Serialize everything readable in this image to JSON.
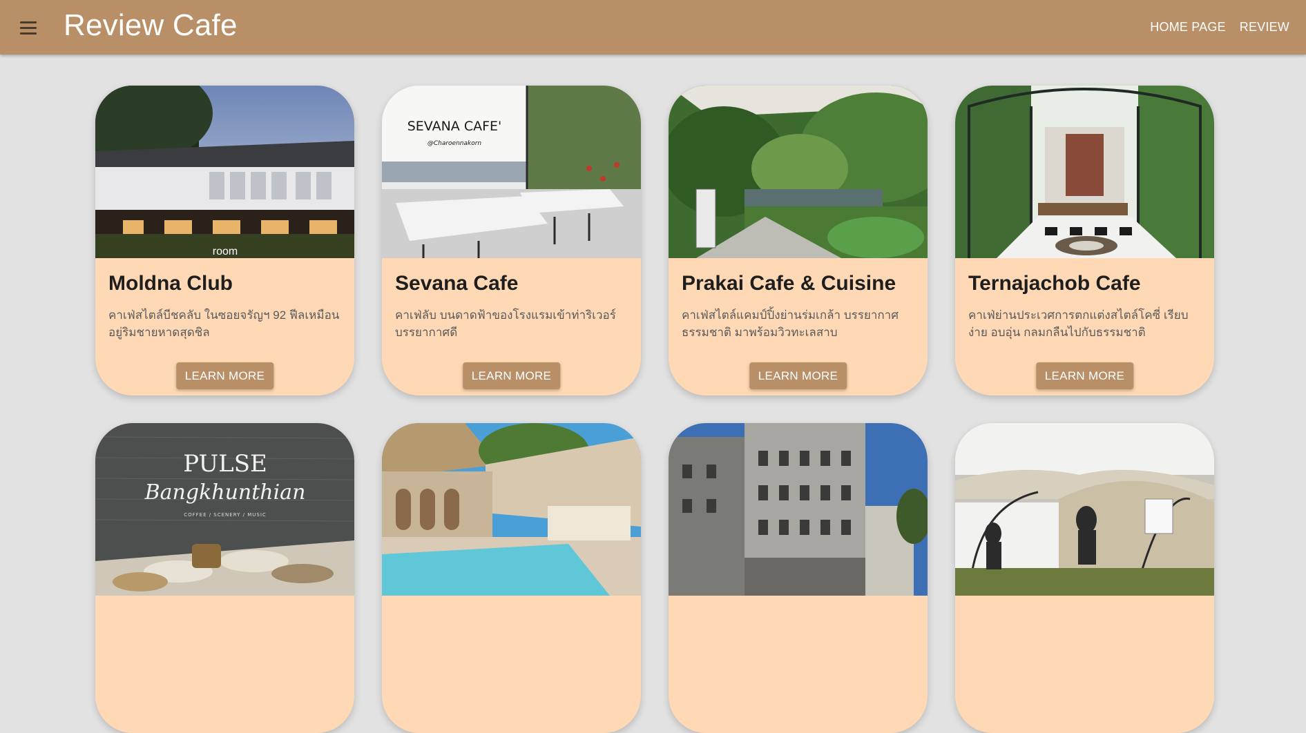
{
  "app": {
    "title": "Review Cafe",
    "nav": [
      "HOME PAGE",
      "REVIEW"
    ]
  },
  "colors": {
    "appbar": "#b88f67",
    "page_bg": "#e2e2e2",
    "card_bg": "#ffd9b5",
    "button": "#b88f67"
  },
  "icons": {
    "menu": "hamburger-menu-icon"
  },
  "cards": [
    {
      "title": "Moldna Club",
      "desc": "คาเฟ่สไตล์บีชคลับ ในซอยจรัญฯ 92 ฟีลเหมือนอยู่ริมชายหาดสุดชิล",
      "button": "LEARN MORE",
      "image_text": "room"
    },
    {
      "title": "Sevana Cafe",
      "desc": "คาเฟ่ลับ บนดาดฟ้าของโรงแรมเข้าท่าริเวอร์ บรรยากาศดี",
      "button": "LEARN MORE",
      "image_text": "SEVANA CAFE'",
      "image_subtext": "@Charoennakorn"
    },
    {
      "title": "Prakai Cafe & Cuisine",
      "desc": "คาเฟ่สไตล์แคมป์ปิ้งย่านร่มเกล้า บรรยากาศธรรมชาติ มาพร้อมวิวทะเลสาบ",
      "button": "LEARN MORE"
    },
    {
      "title": "Ternajachob Cafe",
      "desc": "คาเฟ่ย่านประเวศการตกแต่งสไตล์โคซี่ เรียบง่าย อบอุ่น กลมกลืนไปกับธรรมชาติ",
      "button": "LEARN MORE"
    },
    {
      "image_text": "PULSE",
      "image_subtext": "Bangkhunthian",
      "image_caption": "COFFEE / SCENERY / MUSIC"
    },
    {},
    {},
    {}
  ]
}
